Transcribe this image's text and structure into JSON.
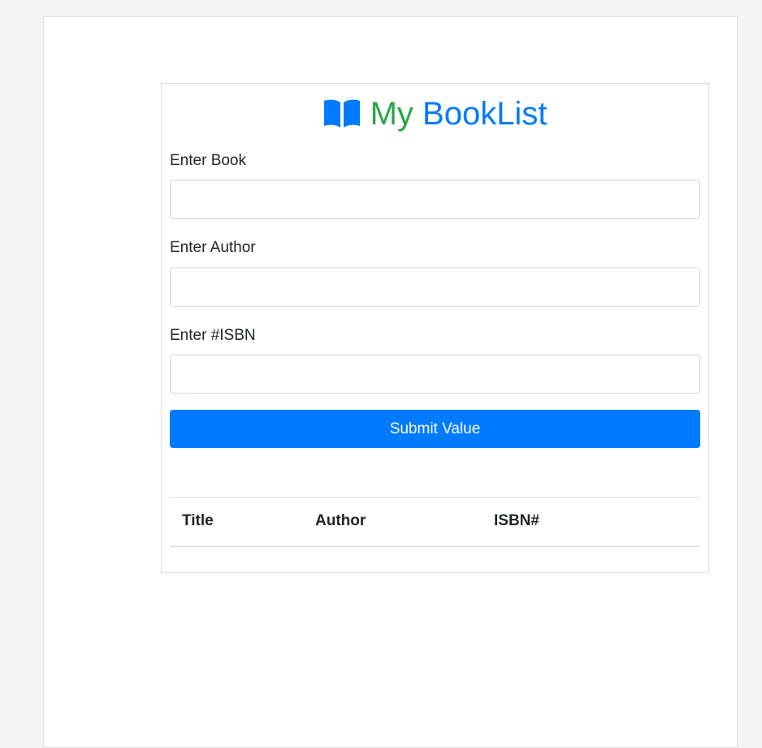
{
  "header": {
    "icon": "open-book-icon",
    "title_part_1": "My",
    "title_part_2": "BookList",
    "colors": {
      "title_part_1": "#28a745",
      "title_part_2": "#007bff",
      "icon": "#007bff"
    }
  },
  "form": {
    "book_label": "Enter Book",
    "book_value": "",
    "author_label": "Enter Author",
    "author_value": "",
    "isbn_label": "Enter #ISBN",
    "isbn_value": "",
    "submit_label": "Submit Value",
    "submit_color": "#007bff"
  },
  "table": {
    "columns": [
      "Title",
      "Author",
      "ISBN#"
    ],
    "rows": []
  }
}
